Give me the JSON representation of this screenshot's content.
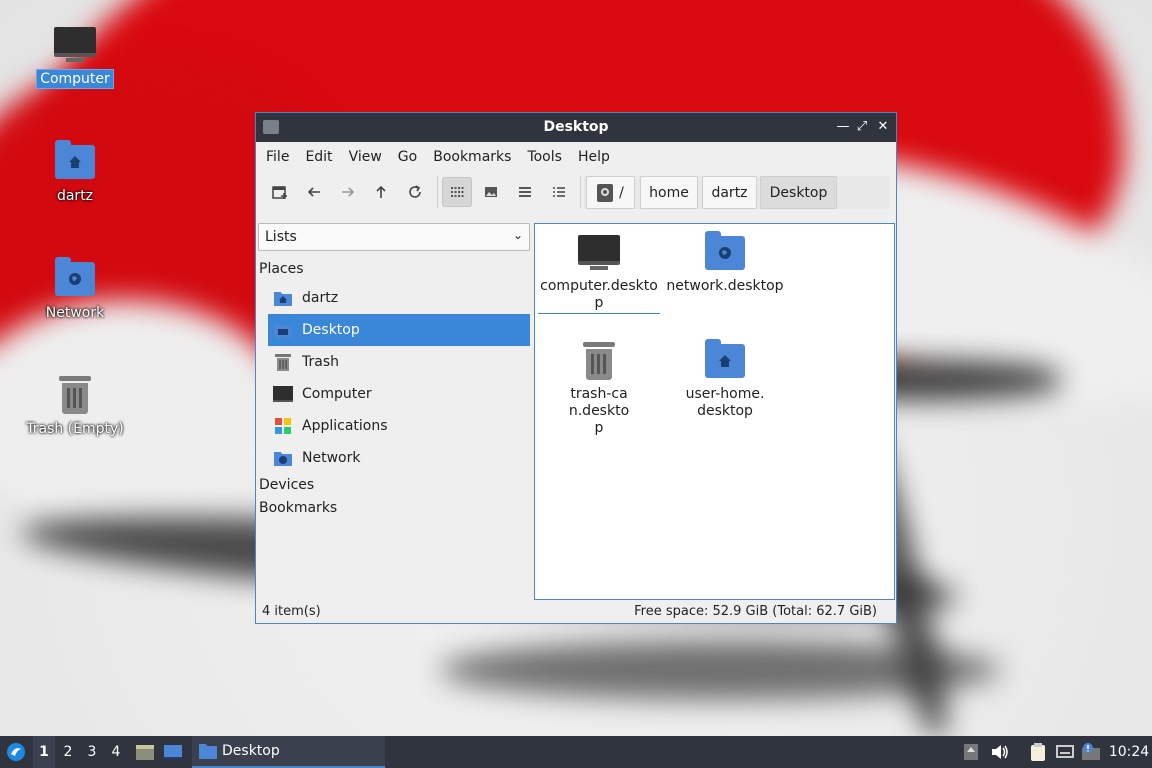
{
  "desktop": {
    "icons": [
      {
        "label": "Computer",
        "icon": "computer-icon",
        "selected": true
      },
      {
        "label": "dartz",
        "icon": "home-folder-icon"
      },
      {
        "label": "Network",
        "icon": "network-folder-icon"
      },
      {
        "label": "Trash (Empty)",
        "icon": "trash-icon"
      }
    ]
  },
  "window": {
    "title": "Desktop",
    "controls": {
      "minimize": "—",
      "maximize": "⤢",
      "close": "✕"
    },
    "menu": [
      "File",
      "Edit",
      "View",
      "Go",
      "Bookmarks",
      "Tools",
      "Help"
    ],
    "toolbar": {
      "icons": [
        "new-tab-icon",
        "back-arrow-icon",
        "forward-arrow-icon",
        "up-arrow-icon",
        "reload-icon",
        "icon-view-icon",
        "thumbnail-view-icon",
        "compact-view-icon",
        "detailed-list-view-icon"
      ]
    },
    "path": {
      "root_label": "/",
      "segments": [
        "home",
        "dartz",
        "Desktop"
      ]
    },
    "side": {
      "selector_value": "Lists",
      "places_header": "Places",
      "places": [
        {
          "label": "dartz",
          "icon": "home-folder-icon"
        },
        {
          "label": "Desktop",
          "icon": "desktop-folder-icon",
          "selected": true
        },
        {
          "label": "Trash",
          "icon": "trash-icon"
        },
        {
          "label": "Computer",
          "icon": "computer-icon"
        },
        {
          "label": "Applications",
          "icon": "applications-icon"
        },
        {
          "label": "Network",
          "icon": "network-folder-icon"
        }
      ],
      "devices_header": "Devices",
      "bookmarks_header": "Bookmarks"
    },
    "files": [
      {
        "label": "computer.desktop",
        "icon": "computer-icon",
        "focused": true
      },
      {
        "label": "network.desktop",
        "icon": "network-folder-icon"
      },
      {
        "label": "trash-can.desktop",
        "icon": "trash-icon"
      },
      {
        "label": "user-home.desktop",
        "icon": "home-folder-icon"
      }
    ],
    "status": {
      "items": "4 item(s)",
      "free_space": "Free space: 52.9 GiB (Total: 62.7 GiB)"
    }
  },
  "taskbar": {
    "workspaces": [
      "1",
      "2",
      "3",
      "4"
    ],
    "active_workspace": "1",
    "task_label": "Desktop",
    "clock": "10:24",
    "tray_icons": [
      "up-arrow-icon",
      "volume-icon",
      "clipboard-icon",
      "network-icon",
      "update-notifier-icon"
    ]
  },
  "colors": {
    "accent": "#3a86d9",
    "folder": "#4b87d6",
    "panel": "#2f343f"
  }
}
